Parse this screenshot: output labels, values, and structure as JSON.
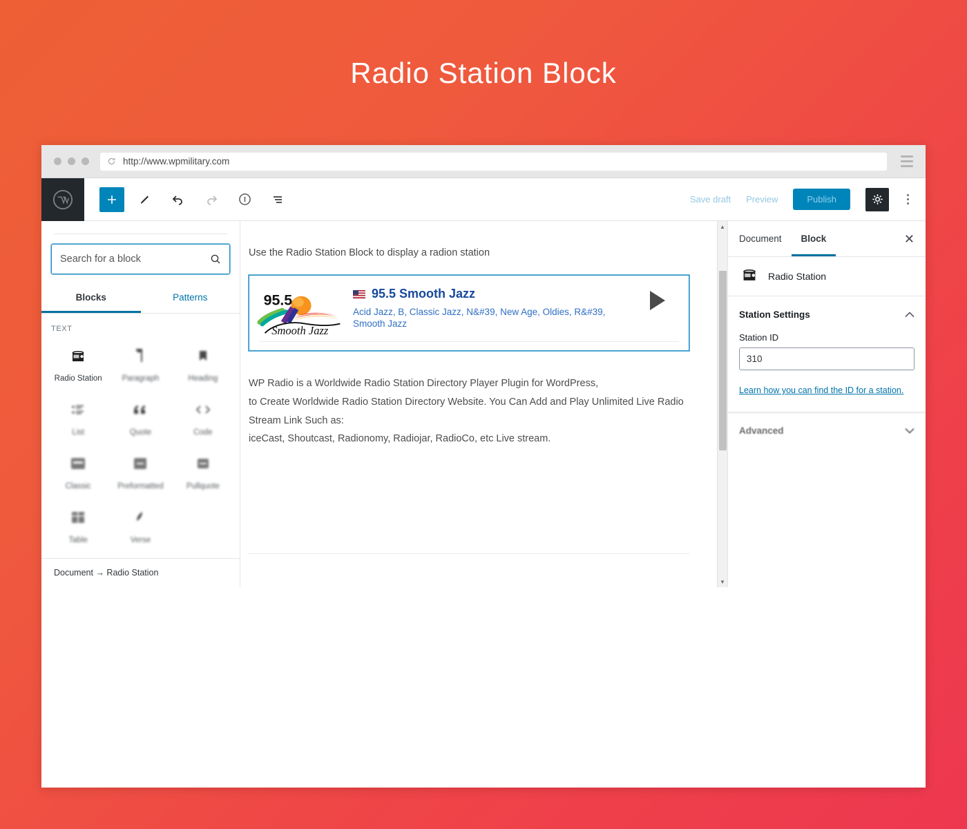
{
  "page": {
    "title": "Radio Station Block",
    "bg_start": "#ee5f35",
    "bg_end": "#ee374f"
  },
  "browser": {
    "url": "http://www.wpmilitary.com",
    "reload_icon": "reload-icon",
    "menu_icon": "hamburger-menu-icon"
  },
  "admin_bar": {
    "logo_icon": "wordpress-logo-icon",
    "tools": [
      {
        "name": "add-block-button",
        "icon": "plus-icon"
      },
      {
        "name": "edit-mode-button",
        "icon": "pencil-icon"
      },
      {
        "name": "undo-button",
        "icon": "undo-arrow-icon"
      },
      {
        "name": "redo-button",
        "icon": "redo-arrow-icon"
      },
      {
        "name": "content-info-button",
        "icon": "info-circle-icon"
      },
      {
        "name": "block-navigation-button",
        "icon": "list-view-icon"
      }
    ],
    "save_draft": "Save draft",
    "preview": "Preview",
    "publish": "Publish",
    "settings_icon": "gear-icon",
    "more_icon": "kebab-menu-icon",
    "publish_bg": "#0085ba"
  },
  "inserter": {
    "search_placeholder": "Search for a block",
    "search_value": "",
    "search_icon": "search-icon",
    "tabs": [
      {
        "label": "Blocks",
        "active": true
      },
      {
        "label": "Patterns",
        "active": false
      }
    ],
    "section_label": "TEXT",
    "blocks": [
      {
        "label": "Radio Station",
        "icon": "radio-icon",
        "highlight": true
      },
      {
        "label": "Paragraph",
        "icon": "paragraph-icon",
        "highlight": false
      },
      {
        "label": "Heading",
        "icon": "heading-icon",
        "highlight": false
      },
      {
        "label": "List",
        "icon": "list-icon",
        "highlight": false
      },
      {
        "label": "Quote",
        "icon": "quote-icon",
        "highlight": false
      },
      {
        "label": "Code",
        "icon": "code-icon",
        "highlight": false
      },
      {
        "label": "Classic",
        "icon": "classic-icon",
        "highlight": false
      },
      {
        "label": "Preformatted",
        "icon": "preformatted-icon",
        "highlight": false
      },
      {
        "label": "Pullquote",
        "icon": "pullquote-icon",
        "highlight": false
      },
      {
        "label": "Table",
        "icon": "table-icon",
        "highlight": false
      },
      {
        "label": "Verse",
        "icon": "verse-icon",
        "highlight": false
      }
    ],
    "breadcrumb": "Document  →  Radio Station"
  },
  "canvas": {
    "intro": "Use the Radio Station Block to display a radion station",
    "station": {
      "logo_text_top": "95.5",
      "logo_text_bottom": "Smooth Jazz",
      "flag_icon": "us-flag-icon",
      "title": "95.5 Smooth Jazz",
      "genres": "Acid Jazz, B, Classic Jazz, N&#39, New Age, Oldies, R&#39, Smooth Jazz",
      "play_icon": "play-icon",
      "title_color": "#18489c",
      "genres_color": "#2f6fc4"
    },
    "paragraphs": [
      "WP Radio is a Worldwide Radio Station Directory Player Plugin for WordPress,",
      "to Create Worldwide Radio Station Directory Website. You Can Add and Play Unlimited Live Radio",
      "Stream Link Such as:",
      "iceCast, Shoutcast, Radionomy, Radiojar, RadioCo, etc Live stream."
    ]
  },
  "settings": {
    "tabs": [
      {
        "label": "Document",
        "active": false
      },
      {
        "label": "Block",
        "active": true
      }
    ],
    "close_icon": "close-icon",
    "block_name": "Radio Station",
    "block_icon": "radio-icon",
    "panels": [
      {
        "title": "Station Settings",
        "expanded": true,
        "chevron": "chevron-up-icon"
      },
      {
        "title": "Advanced",
        "expanded": false,
        "chevron": "chevron-down-icon"
      }
    ],
    "station_id_label": "Station ID",
    "station_id_value": "310",
    "help_link": "Learn how you can find the ID for a station.",
    "accent": "#0071a1"
  }
}
